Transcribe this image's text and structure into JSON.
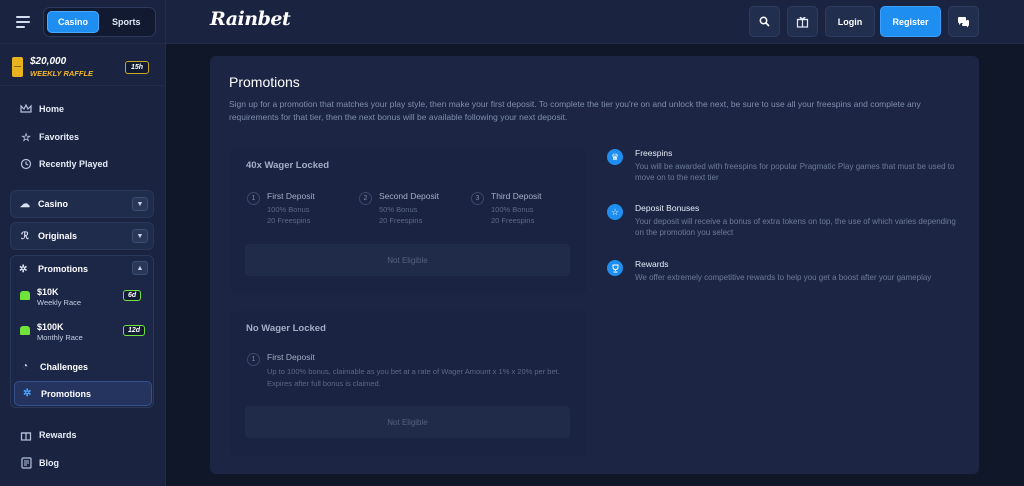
{
  "sidebar": {
    "modes": [
      "Casino",
      "Sports"
    ],
    "raffle": {
      "amount": "$20,000",
      "label": "WEEKLY RAFFLE",
      "time": "15h"
    },
    "nav": [
      {
        "label": "Home",
        "icon": "crown-icon"
      },
      {
        "label": "Favorites",
        "icon": "star-icon"
      },
      {
        "label": "Recently Played",
        "icon": "history-icon"
      }
    ],
    "sections": [
      {
        "label": "Casino",
        "icon": "dice-icon"
      },
      {
        "label": "Originals",
        "icon": "originals-icon"
      }
    ],
    "promotions": {
      "label": "Promotions",
      "races": [
        {
          "title": "$10K",
          "sub": "Weekly Race",
          "badge": "6d"
        },
        {
          "title": "$100K",
          "sub": "Monthly Race",
          "badge": "12d"
        }
      ],
      "challenges": "Challenges",
      "active": "Promotions"
    },
    "bottom": [
      {
        "label": "Rewards",
        "icon": "gift-icon"
      },
      {
        "label": "Blog",
        "icon": "blog-icon"
      }
    ]
  },
  "header": {
    "logo": "Rainbet",
    "login": "Login",
    "register": "Register"
  },
  "page": {
    "title": "Promotions",
    "description": "Sign up for a promotion that matches your play style, then make your first deposit. To complete the tier you're on and unlock the next, be sure to use all your freespins and complete any requirements for that tier, then the next bonus will be available following your next deposit.",
    "tiers": [
      {
        "title": "40x Wager Locked",
        "steps": [
          {
            "num": "1",
            "title": "First Deposit",
            "line1": "100% Bonus",
            "line2": "20 Freespins"
          },
          {
            "num": "2",
            "title": "Second Deposit",
            "line1": "50% Bonus",
            "line2": "20 Freespins"
          },
          {
            "num": "3",
            "title": "Third Deposit",
            "line1": "100% Bonus",
            "line2": "20 Freespins"
          }
        ],
        "button": "Not Eligible"
      },
      {
        "title": "No Wager Locked",
        "steps": [
          {
            "num": "1",
            "title": "First Deposit",
            "text": "Up to 100% bonus, claimable as you bet at a rate of Wager Amount x 1% x 20% per bet. Expires after full bonus is claimed."
          }
        ],
        "button": "Not Eligible"
      }
    ],
    "info": [
      {
        "title": "Freespins",
        "icon": "crown-icon",
        "text": "You will be awarded with freespins for popular Pragmatic Play games that must be used to move on to the next tier"
      },
      {
        "title": "Deposit Bonuses",
        "icon": "star-icon",
        "text": "Your deposit will receive a bonus of extra tokens on top, the use of which varies depending on the promotion you select"
      },
      {
        "title": "Rewards",
        "icon": "trophy-icon",
        "text": "We offer extremely competitive rewards to help you get a boost after your gameplay"
      }
    ]
  }
}
